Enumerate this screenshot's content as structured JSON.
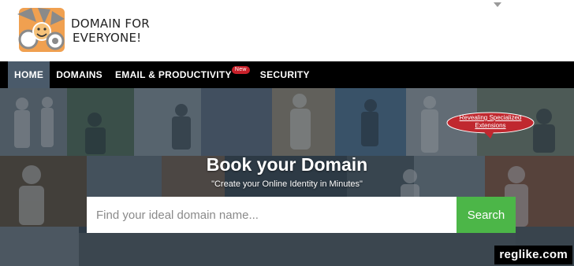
{
  "logo": {
    "line1": "DOMAIN FOR",
    "line2": "EVERYONE!",
    "colors": {
      "orange": "#f0a050",
      "gray": "#8a8a8a"
    }
  },
  "nav": {
    "items": [
      {
        "label": "HOME",
        "active": true
      },
      {
        "label": "DOMAINS",
        "active": false
      },
      {
        "label": "EMAIL & PRODUCTIVITY",
        "active": false,
        "badge": "New"
      },
      {
        "label": "SECURITY",
        "active": false
      }
    ]
  },
  "hero": {
    "title": "Book your Domain",
    "subtitle": "\"Create your Online Identity in Minutes\"",
    "bubble": "Revealing Specialized Extensions",
    "search": {
      "placeholder": "Find your ideal domain name...",
      "button": "Search"
    }
  },
  "watermark": "reglike.com",
  "colors": {
    "nav_bg": "#000000",
    "active_bg": "#4a5a6a",
    "search_button": "#4cb648",
    "badge": "#c8202a"
  }
}
